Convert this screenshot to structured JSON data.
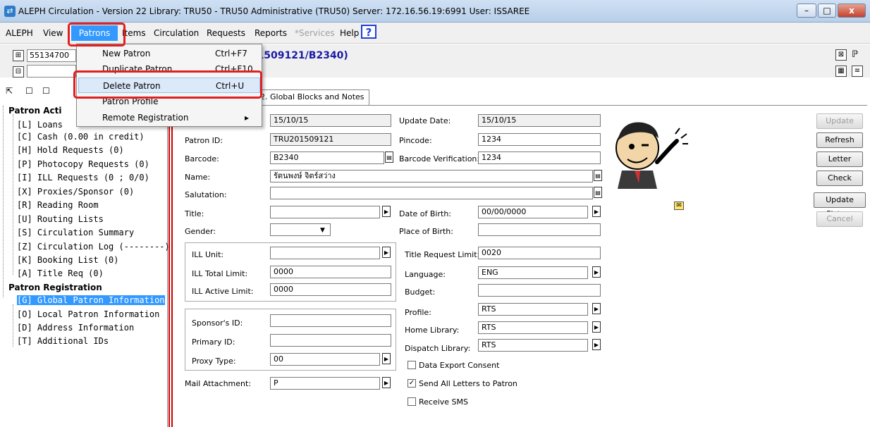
{
  "window": {
    "title": "ALEPH Circulation - Version 22 Library: TRU50 - TRU50 Administrative (TRU50) Server: 172.16.56.19:6991 User: ISSAREE"
  },
  "menubar": {
    "items": [
      "ALEPH",
      "View",
      "Patrons",
      "Items",
      "Circulation",
      "Requests",
      "Reports",
      "*Services",
      "Help"
    ]
  },
  "patrons_menu": {
    "items": [
      {
        "label": "New Patron",
        "shortcut": "Ctrl+F7"
      },
      {
        "label": "Duplicate Patron",
        "shortcut": "Ctrl+F10"
      },
      {
        "label": "Delete Patron",
        "shortcut": "Ctrl+U"
      },
      {
        "label": "Patron Profile",
        "shortcut": ""
      },
      {
        "label": "Remote Registration",
        "shortcut": "▸"
      }
    ]
  },
  "toolbar": {
    "patron_id_field": "55134700",
    "patron_header": "201509121/B2340)"
  },
  "tree": {
    "section1": "Patron Acti",
    "items1": [
      "[L] Loans",
      "[C] Cash (0.00 in credit)",
      "[H] Hold Requests (0)",
      "[P] Photocopy Requests (0)",
      "[I] ILL Requests (0 ; 0/0)",
      "[X] Proxies/Sponsor (0)",
      "[R] Reading Room",
      "[U] Routing Lists",
      "[S] Circulation Summary",
      "[Z] Circulation Log (--------)",
      "[K] Booking List (0)",
      "[A] Title Req (0)"
    ],
    "section2": "Patron Registration",
    "items2": [
      "[G] Global Patron Information",
      "[O] Local Patron Information",
      "[D] Address Information",
      "[T] Additional IDs"
    ]
  },
  "tabs": [
    "s",
    "2. Global Blocks and Notes"
  ],
  "form": {
    "date_value": "15/10/15",
    "update_date_label": "Update Date:",
    "update_date": "15/10/15",
    "patron_id_label": "Patron ID:",
    "patron_id": "TRU201509121",
    "pincode_label": "Pincode:",
    "pincode": "1234",
    "barcode_label": "Barcode:",
    "barcode": "B2340",
    "barcode_ver_label": "Barcode Verification:",
    "barcode_ver": "1234",
    "name_label": "Name:",
    "name": "รัตนพงษ์ จิตร์สว่าง",
    "salutation_label": "Salutation:",
    "salutation": "",
    "title_label": "Title:",
    "title": "",
    "dob_label": "Date of Birth:",
    "dob": "00/00/0000",
    "gender_label": "Gender:",
    "gender": "",
    "pob_label": "Place of Birth:",
    "pob": "",
    "ill_unit_label": "ILL Unit:",
    "ill_unit": "",
    "ill_total_label": "ILL Total Limit:",
    "ill_total": "0000",
    "ill_active_label": "ILL Active Limit:",
    "ill_active": "0000",
    "title_req_label": "Title Request Limit:",
    "title_req": "0020",
    "language_label": "Language:",
    "language": "ENG",
    "budget_label": "Budget:",
    "budget": "",
    "profile_label": "Profile:",
    "profile": "RTS",
    "home_lib_label": "Home Library:",
    "home_lib": "RTS",
    "dispatch_lib_label": "Dispatch Library:",
    "dispatch_lib": "RTS",
    "sponsor_label": "Sponsor's ID:",
    "sponsor": "",
    "primary_label": "Primary ID:",
    "primary": "",
    "proxy_label": "Proxy Type:",
    "proxy": "00",
    "mail_label": "Mail Attachment:",
    "mail": "P",
    "data_export_label": "Data Export Consent",
    "send_all_label": "Send All Letters to Patron",
    "receive_sms_label": "Receive SMS"
  },
  "buttons": {
    "update": "Update",
    "refresh": "Refresh",
    "letter": "Letter",
    "check": "Check",
    "update_picture": "Update Picture",
    "cancel": "Cancel"
  }
}
